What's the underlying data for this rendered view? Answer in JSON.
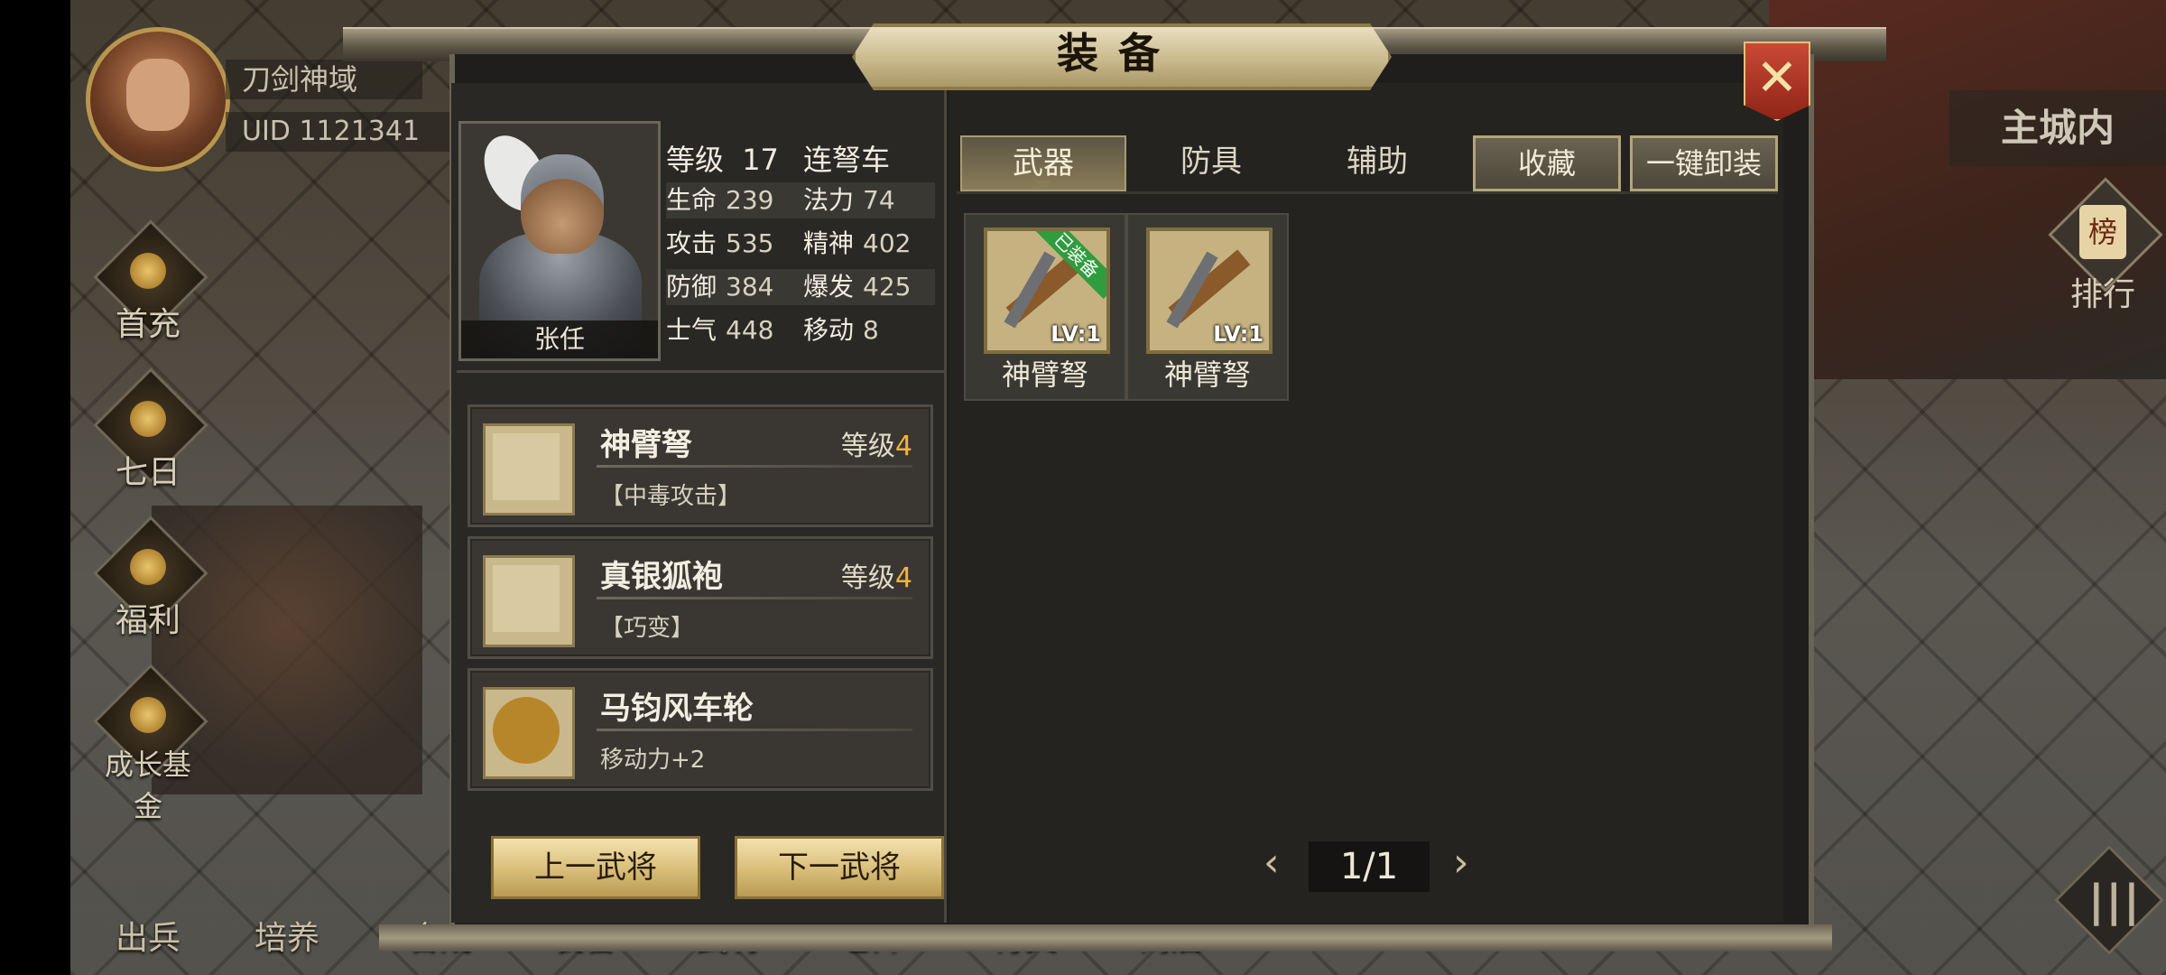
{
  "player": {
    "server": "刀剑神域",
    "uid": "UID  1121341"
  },
  "left_menu": [
    "首充",
    "七日",
    "福利",
    "成长基金"
  ],
  "bottom_nav": [
    "出兵",
    "培养",
    "合成",
    "装备",
    "武将",
    "仓库",
    "符文",
    "商店"
  ],
  "right": {
    "city": "主城内",
    "rank_badge": "榜",
    "rank_label": "排行"
  },
  "dialog": {
    "title": "装备",
    "close": "✕",
    "hero": {
      "name": "张任",
      "level_label": "等级",
      "level": "17",
      "unit": "连弩车",
      "stats": [
        {
          "k": "生命",
          "v": "239"
        },
        {
          "k": "法力",
          "v": "74"
        },
        {
          "k": "攻击",
          "v": "535"
        },
        {
          "k": "精神",
          "v": "402"
        },
        {
          "k": "防御",
          "v": "384"
        },
        {
          "k": "爆发",
          "v": "425"
        },
        {
          "k": "士气",
          "v": "448"
        },
        {
          "k": "移动",
          "v": "8"
        }
      ]
    },
    "equipped": [
      {
        "name": "神臂弩",
        "level_label": "等级",
        "level": "4",
        "desc": "【中毒攻击】"
      },
      {
        "name": "真银狐袍",
        "level_label": "等级",
        "level": "4",
        "desc": "【巧变】"
      },
      {
        "name": "马钧风车轮",
        "level_label": "",
        "level": "",
        "desc": "移动力+2"
      }
    ],
    "prev_hero": "上一武将",
    "next_hero": "下一武将",
    "tabs": [
      "武器",
      "防具",
      "辅助"
    ],
    "active_tab": "武器",
    "favorite": "收藏",
    "unequip_all": "一键卸装",
    "inventory": [
      {
        "name": "神臂弩",
        "lv": "LV:1",
        "ribbon": "已装备"
      },
      {
        "name": "神臂弩",
        "lv": "LV:1",
        "ribbon": ""
      }
    ],
    "pager": {
      "prev": "‹",
      "page": "1/1",
      "next": "›"
    }
  },
  "colors": {
    "gold": "#d8bd78",
    "equipped_ribbon": "#2f9c3e",
    "level_value": "#f0b33c",
    "close": "#c94a36"
  }
}
